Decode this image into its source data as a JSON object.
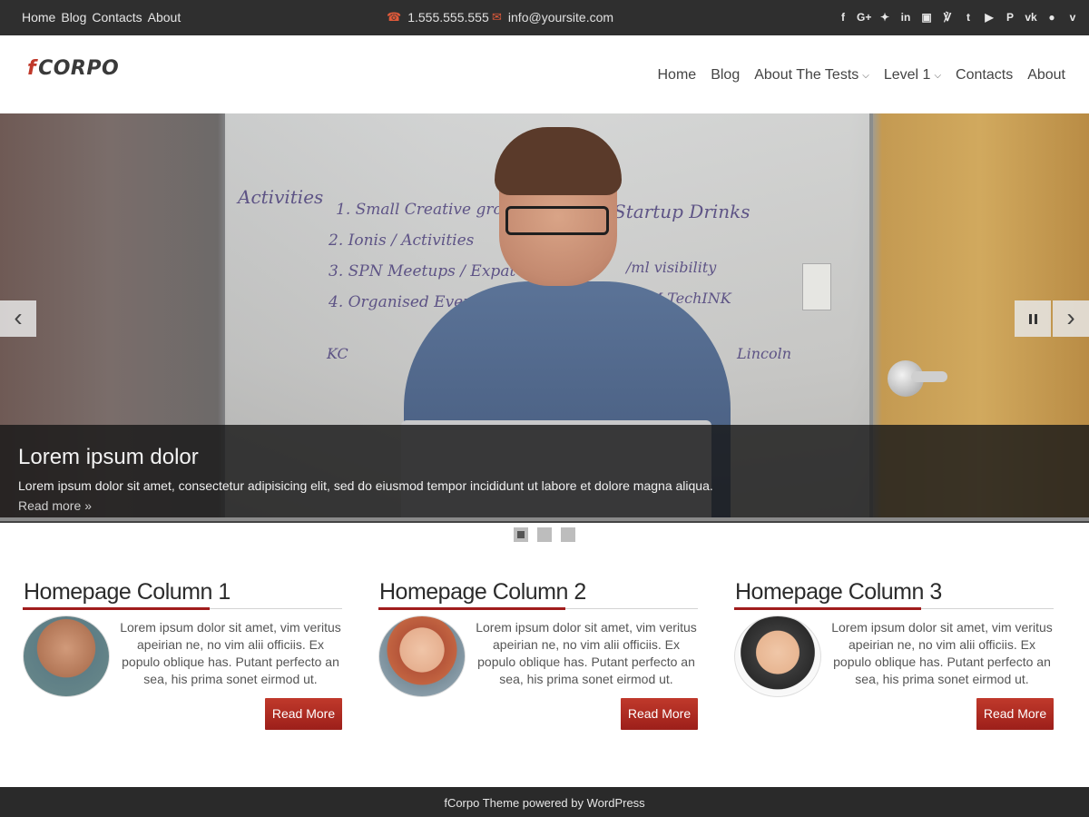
{
  "topbar": {
    "nav": [
      "Home",
      "Blog",
      "Contacts",
      "About"
    ],
    "phone": "1.555.555.555",
    "email": "info@yoursite.com",
    "social_icons": [
      "facebook-icon",
      "google-plus-icon",
      "twitter-icon",
      "linkedin-icon",
      "instagram-icon",
      "rss-icon",
      "tumblr-icon",
      "youtube-icon",
      "pinterest-icon",
      "vk-icon",
      "flickr-icon",
      "vine-icon"
    ]
  },
  "header": {
    "logo_f": "f",
    "logo_rest": "CORPO",
    "menu": [
      {
        "label": "Home",
        "has_children": false
      },
      {
        "label": "Blog",
        "has_children": false
      },
      {
        "label": "About The Tests",
        "has_children": true
      },
      {
        "label": "Level 1",
        "has_children": true
      },
      {
        "label": "Contacts",
        "has_children": false
      },
      {
        "label": "About",
        "has_children": false
      }
    ]
  },
  "slider": {
    "caption_title": "Lorem ipsum dolor",
    "caption_text": "Lorem ipsum dolor sit amet, consectetur adipisicing elit, sed do eiusmod tempor incididunt ut labore et dolore magna aliqua.",
    "read_more": "Read more",
    "slide_count": 3,
    "active_slide": 1
  },
  "columns": [
    {
      "title": "Homepage Column 1",
      "text": "Lorem ipsum dolor sit amet, vim veritus apeirian ne, no vim alii officiis. Ex populo oblique has. Putant perfecto an sea, his prima sonet eirmod ut.",
      "button": "Read More"
    },
    {
      "title": "Homepage Column 2",
      "text": "Lorem ipsum dolor sit amet, vim veritus apeirian ne, no vim alii officiis. Ex populo oblique has. Putant perfecto an sea, his prima sonet eirmod ut.",
      "button": "Read More"
    },
    {
      "title": "Homepage Column 3",
      "text": "Lorem ipsum dolor sit amet, vim veritus apeirian ne, no vim alii officiis. Ex populo oblique has. Putant perfecto an sea, his prima sonet eirmod ut.",
      "button": "Read More"
    }
  ],
  "footer": {
    "text": "fCorpo Theme powered by WordPress"
  },
  "colors": {
    "accent": "#c0392b",
    "topbar_bg": "#2f2f2f",
    "footer_bg": "#2a2a2a"
  }
}
